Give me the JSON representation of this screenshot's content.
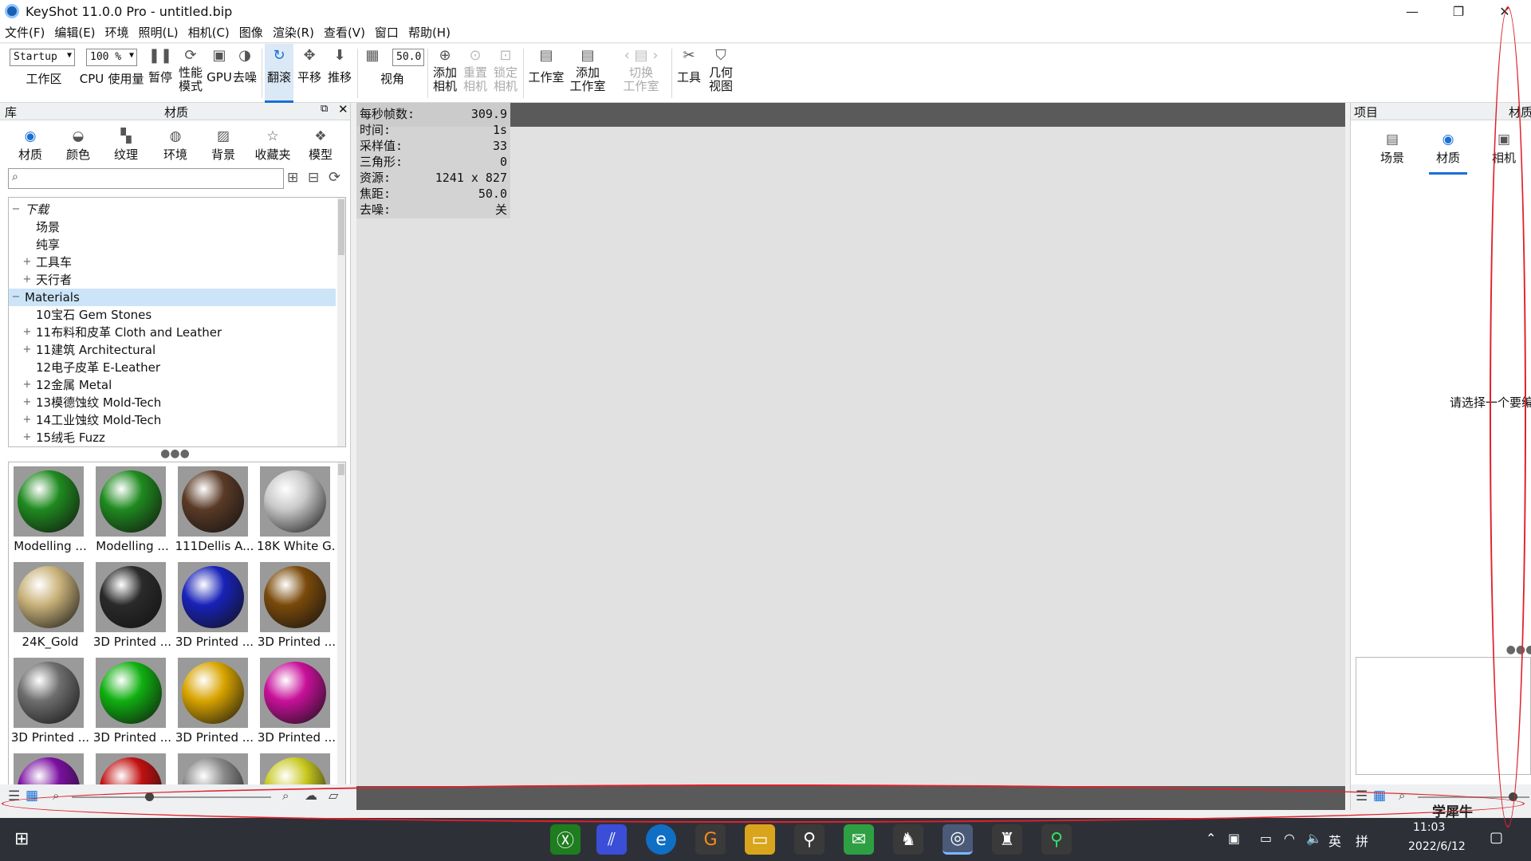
{
  "window": {
    "title": "KeyShot 11.0.0 Pro  - untitled.bip",
    "minimize": "—",
    "restore": "❐",
    "close": "✕"
  },
  "menu": [
    "文件(F)",
    "编辑(E)",
    "环境",
    "照明(L)",
    "相机(C)",
    "图像",
    "渲染(R)",
    "查看(V)",
    "窗口",
    "帮助(H)"
  ],
  "toolbar": {
    "workspace_value": "Startup",
    "workspace_label": "工作区",
    "zoom_value": "100 %",
    "cpu_label": "CPU",
    "usage_label": "使用量",
    "pause_label": "暂停",
    "perf_label_1": "性能",
    "perf_label_2": "模式",
    "gpu_label": "GPU",
    "denoise_label": "去噪",
    "tumble_label": "翻滚",
    "pan_label": "平移",
    "dolly_label": "推移",
    "fov_value": "50.0",
    "fov_label": "视角",
    "add_camera_1": "添加",
    "add_camera_2": "相机",
    "reset_camera_1": "重置",
    "reset_camera_2": "相机",
    "lock_camera_1": "锁定",
    "lock_camera_2": "相机",
    "studio_label": "工作室",
    "add_studio_1": "添加",
    "add_studio_2": "工作室",
    "switch_studio_1": "切换",
    "switch_studio_2": "工作室",
    "tools_label": "工具",
    "geometry_1": "几何",
    "geometry_2": "视图"
  },
  "library": {
    "header_left": "库",
    "header_title": "材质",
    "tabs": [
      "材质",
      "颜色",
      "纹理",
      "环境",
      "背景",
      "收藏夹",
      "模型"
    ],
    "search_placeholder": "",
    "tree": [
      {
        "label": "下载",
        "indent": 0,
        "exp": "−",
        "italic": true
      },
      {
        "label": "场景",
        "indent": 2,
        "exp": ""
      },
      {
        "label": "纯享",
        "indent": 2,
        "exp": ""
      },
      {
        "label": "工具车",
        "indent": 2,
        "exp": "+"
      },
      {
        "label": "天行者",
        "indent": 2,
        "exp": "+"
      },
      {
        "label": "Materials",
        "indent": 1,
        "exp": "−",
        "selected": true
      },
      {
        "label": "10宝石 Gem Stones",
        "indent": 2,
        "exp": ""
      },
      {
        "label": "11布料和皮革 Cloth and Leather",
        "indent": 2,
        "exp": "+"
      },
      {
        "label": "11建筑 Architectural",
        "indent": 2,
        "exp": "+"
      },
      {
        "label": "12电子皮革 E-Leather",
        "indent": 2,
        "exp": ""
      },
      {
        "label": "12金属 Metal",
        "indent": 2,
        "exp": "+"
      },
      {
        "label": "13模德蚀纹 Mold-Tech",
        "indent": 2,
        "exp": "+"
      },
      {
        "label": "14工业蚀纹 Mold-Tech",
        "indent": 2,
        "exp": "+"
      },
      {
        "label": "15绒毛 Fuzz",
        "indent": 2,
        "exp": "+"
      }
    ],
    "thumbs": [
      {
        "label": "Modelling ...",
        "color": "#1f8a1f"
      },
      {
        "label": "Modelling ...",
        "color": "#1f8a1f"
      },
      {
        "label": "111Dellis A...",
        "color": "#5a3a26"
      },
      {
        "label": "18K White G...",
        "color": "#c9c9c9"
      },
      {
        "label": "24K_Gold",
        "color": "#c9b27a"
      },
      {
        "label": "3D Printed ...",
        "color": "#2a2a2a"
      },
      {
        "label": "3D Printed ...",
        "color": "#1822b8"
      },
      {
        "label": "3D Printed ...",
        "color": "#7a4a0a"
      },
      {
        "label": "3D Printed ...",
        "color": "#6e6e6e"
      },
      {
        "label": "3D Printed ...",
        "color": "#10b010"
      },
      {
        "label": "3D Printed ...",
        "color": "#d8a400"
      },
      {
        "label": "3D Printed ...",
        "color": "#c8109a"
      },
      {
        "label": "",
        "color": "#7a10a0"
      },
      {
        "label": "",
        "color": "#c01010"
      },
      {
        "label": "",
        "color": "#8a8a8a"
      },
      {
        "label": "",
        "color": "#c8c820"
      }
    ]
  },
  "stats": [
    {
      "k": "每秒帧数:",
      "v": "309.9"
    },
    {
      "k": "时间:",
      "v": "1s"
    },
    {
      "k": "采样值:",
      "v": "33"
    },
    {
      "k": "三角形:",
      "v": "0"
    },
    {
      "k": "资源:",
      "v": "1241 x 827"
    },
    {
      "k": "焦距:",
      "v": "50.0"
    },
    {
      "k": "去噪:",
      "v": "关"
    }
  ],
  "project": {
    "header": "项目",
    "header_right": "材质",
    "tabs": [
      "场景",
      "材质",
      "相机"
    ],
    "empty_text": "请选择一个要编"
  },
  "taskbar": {
    "time": "11:03",
    "date": "2022/6/12",
    "lang": "英",
    "ime": "拼",
    "watermark": "学犀牛"
  }
}
